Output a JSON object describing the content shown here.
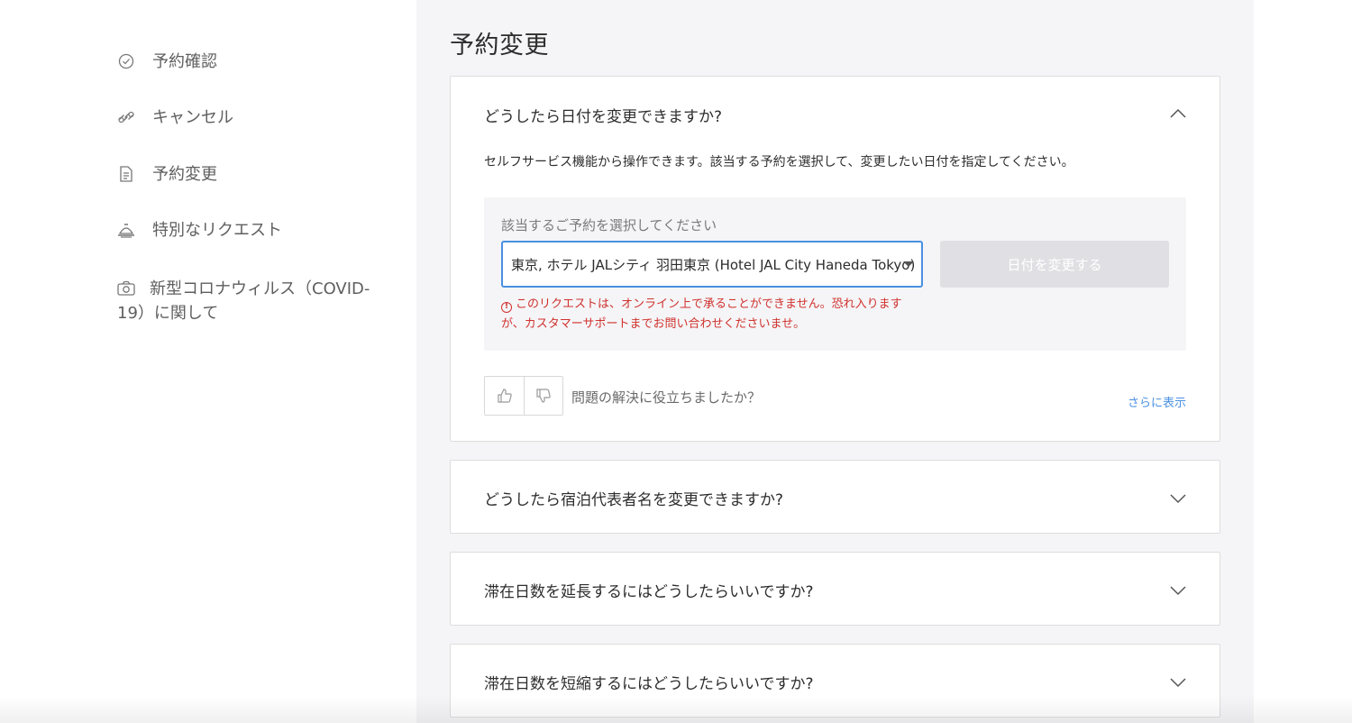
{
  "sidebar": {
    "items": [
      {
        "label": "予約確認",
        "icon": "check-circle-icon"
      },
      {
        "label": "キャンセル",
        "icon": "broken-link-icon"
      },
      {
        "label": "予約変更",
        "icon": "document-icon"
      },
      {
        "label": "特別なリクエスト",
        "icon": "concierge-bell-icon"
      },
      {
        "label": "新型コロナウィルス（COVID-19）に関して",
        "icon": "camera-icon"
      }
    ]
  },
  "main": {
    "title": "予約変更",
    "faq": [
      {
        "question": "どうしたら日付を変更できますか?",
        "expanded": true,
        "answer": "セルフサービス機能から操作できます。該当する予約を選択して、変更したい日付を指定してください。",
        "form": {
          "label": "該当するご予約を選択してください",
          "selected": "東京, ホテル JALシティ 羽田東京 (Hotel JAL City Haneda Tokyo)",
          "button": "日付を変更する",
          "error": "このリクエストは、オンライン上で承ることができません。恐れ入りますが、カスタマーサポートまでお問い合わせくださいませ。"
        },
        "feedback": {
          "question": "問題の解決に役立ちましたか？",
          "more": "さらに表示"
        }
      },
      {
        "question": "どうしたら宿泊代表者名を変更できますか?",
        "expanded": false
      },
      {
        "question": "滞在日数を延長するにはどうしたらいいですか?",
        "expanded": false
      },
      {
        "question": "滞在日数を短縮するにはどうしたらいいですか?",
        "expanded": false
      }
    ]
  },
  "colors": {
    "accent": "#4a90e2",
    "error": "#d0312d",
    "panel": "#f5f5f7",
    "disabled_button": "#e0e0e4"
  }
}
